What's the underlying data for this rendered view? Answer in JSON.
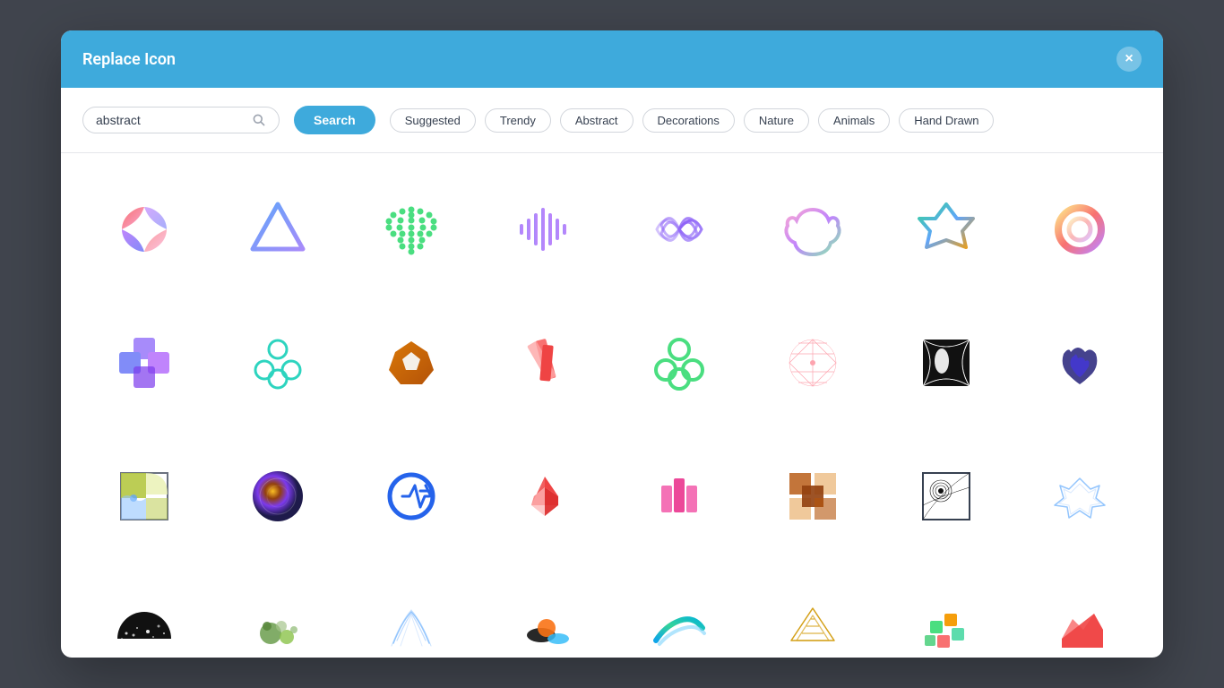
{
  "modal": {
    "title": "Replace Icon",
    "close_label": "×"
  },
  "search": {
    "value": "abstract",
    "placeholder": "abstract",
    "button_label": "Search"
  },
  "filters": {
    "tags": [
      "Suggested",
      "Trendy",
      "Abstract",
      "Decorations",
      "Nature",
      "Animals",
      "Hand Drawn"
    ]
  },
  "icons": {
    "rows": [
      [
        "icon-lotus-pink",
        "icon-triangle-blue",
        "icon-dots-green",
        "icon-wave-purple",
        "icon-swirl-purple",
        "icon-lotus-gradient",
        "icon-hexagon-rainbow",
        "icon-ring-gradient"
      ],
      [
        "icon-cross-purple",
        "icon-clover-teal",
        "icon-pentagon-gold",
        "icon-plus-red",
        "icon-clover-green",
        "icon-rays-pink",
        "icon-wave-bw",
        "icon-gem-navy"
      ],
      [
        "icon-spiral-square",
        "icon-circle-brown",
        "icon-arrow-circle-blue",
        "icon-mountain-red",
        "icon-bars-pink",
        "icon-pixel-gold",
        "icon-eye-circle-bw",
        "icon-gem-outline"
      ],
      [
        "icon-halfcircle-black",
        "icon-blob-green",
        "icon-arch-outline",
        "icon-pebble-orange",
        "icon-wave-teal",
        "icon-diamond-outline",
        "icon-blocks-colorful",
        "icon-arch-red"
      ]
    ]
  }
}
